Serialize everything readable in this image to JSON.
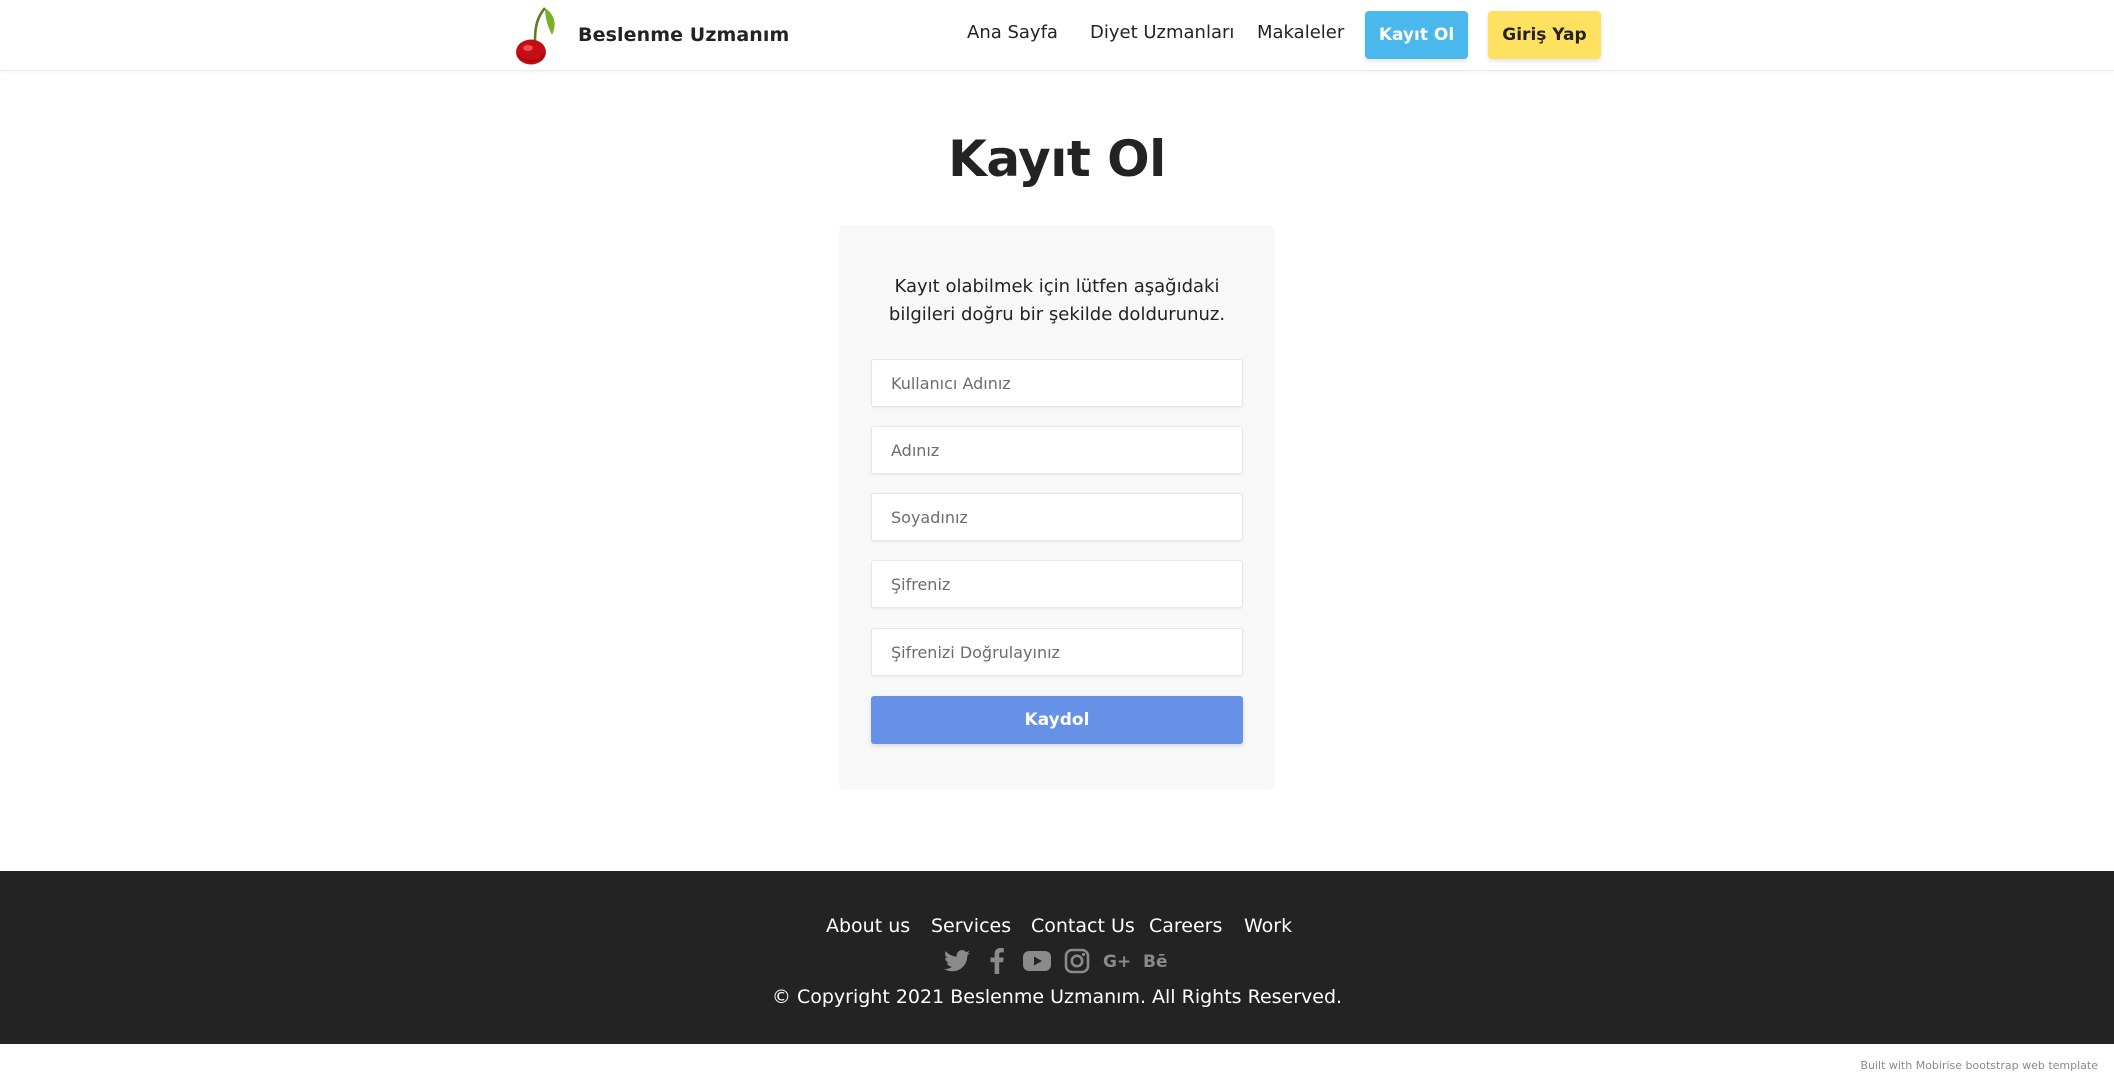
{
  "navbar": {
    "brand_name": "Beslenme Uzmanım",
    "links": [
      "Ana Sayfa",
      "Diyet Uzmanları",
      "Makaleler"
    ],
    "register_button": "Kayıt Ol",
    "login_button": "Giriş Yap",
    "colors": {
      "register": "#4ab8ec",
      "login": "#ffe161"
    }
  },
  "main": {
    "title": "Kayıt Ol",
    "intro": "Kayıt olabilmek için lütfen aşağıdaki bilgileri doğru bir şekilde doldurunuz.",
    "fields": {
      "username_placeholder": "Kullanıcı Adınız",
      "firstname_placeholder": "Adınız",
      "lastname_placeholder": "Soyadınız",
      "password_placeholder": "Şifreniz",
      "password_confirm_placeholder": "Şifrenizi Doğrulayınız"
    },
    "submit_label": "Kaydol",
    "submit_color": "#6592e6"
  },
  "footer": {
    "links": [
      "About us",
      "Services",
      "Contact Us",
      "Careers",
      "Work"
    ],
    "social_icons": [
      "twitter-icon",
      "facebook-icon",
      "youtube-icon",
      "instagram-icon",
      "google-plus-icon",
      "behance-icon"
    ],
    "copyright": "© Copyright 2021 Beslenme Uzmanım. All Rights Reserved.",
    "background": "#232323"
  },
  "credit": "Built with Mobirise bootstrap web template"
}
